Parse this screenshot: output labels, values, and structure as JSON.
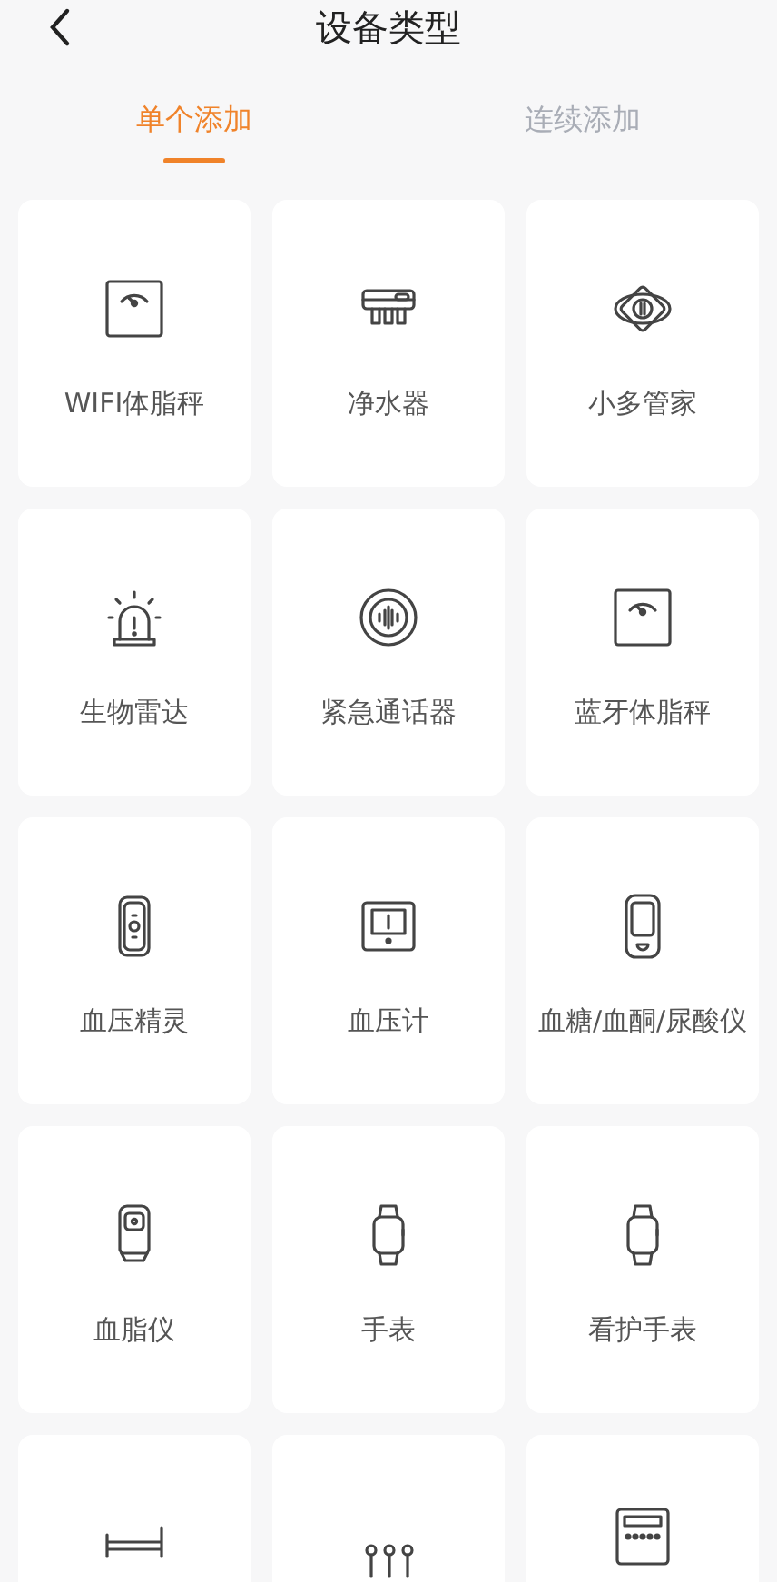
{
  "header": {
    "title": "设备类型"
  },
  "tabs": [
    {
      "label": "单个添加",
      "selected": true
    },
    {
      "label": "连续添加",
      "selected": false
    }
  ],
  "devices": [
    {
      "kind": "device",
      "label": "WIFI体脂秤"
    },
    {
      "kind": "device",
      "label": "净水器"
    },
    {
      "kind": "device",
      "label": "小多管家"
    },
    {
      "kind": "device",
      "label": "生物雷达"
    },
    {
      "kind": "device",
      "label": "紧急通话器"
    },
    {
      "kind": "device",
      "label": "蓝牙体脂秤"
    },
    {
      "kind": "device",
      "label": "血压精灵"
    },
    {
      "kind": "device",
      "label": "血压计"
    },
    {
      "kind": "device",
      "label": "血糖/血酮/尿酸仪"
    },
    {
      "kind": "device",
      "label": "血脂仪"
    },
    {
      "kind": "device",
      "label": "手表"
    },
    {
      "kind": "device",
      "label": "看护手表"
    },
    {
      "kind": "cut_off"
    },
    {
      "kind": "cut_off"
    },
    {
      "kind": "cut_off"
    }
  ]
}
